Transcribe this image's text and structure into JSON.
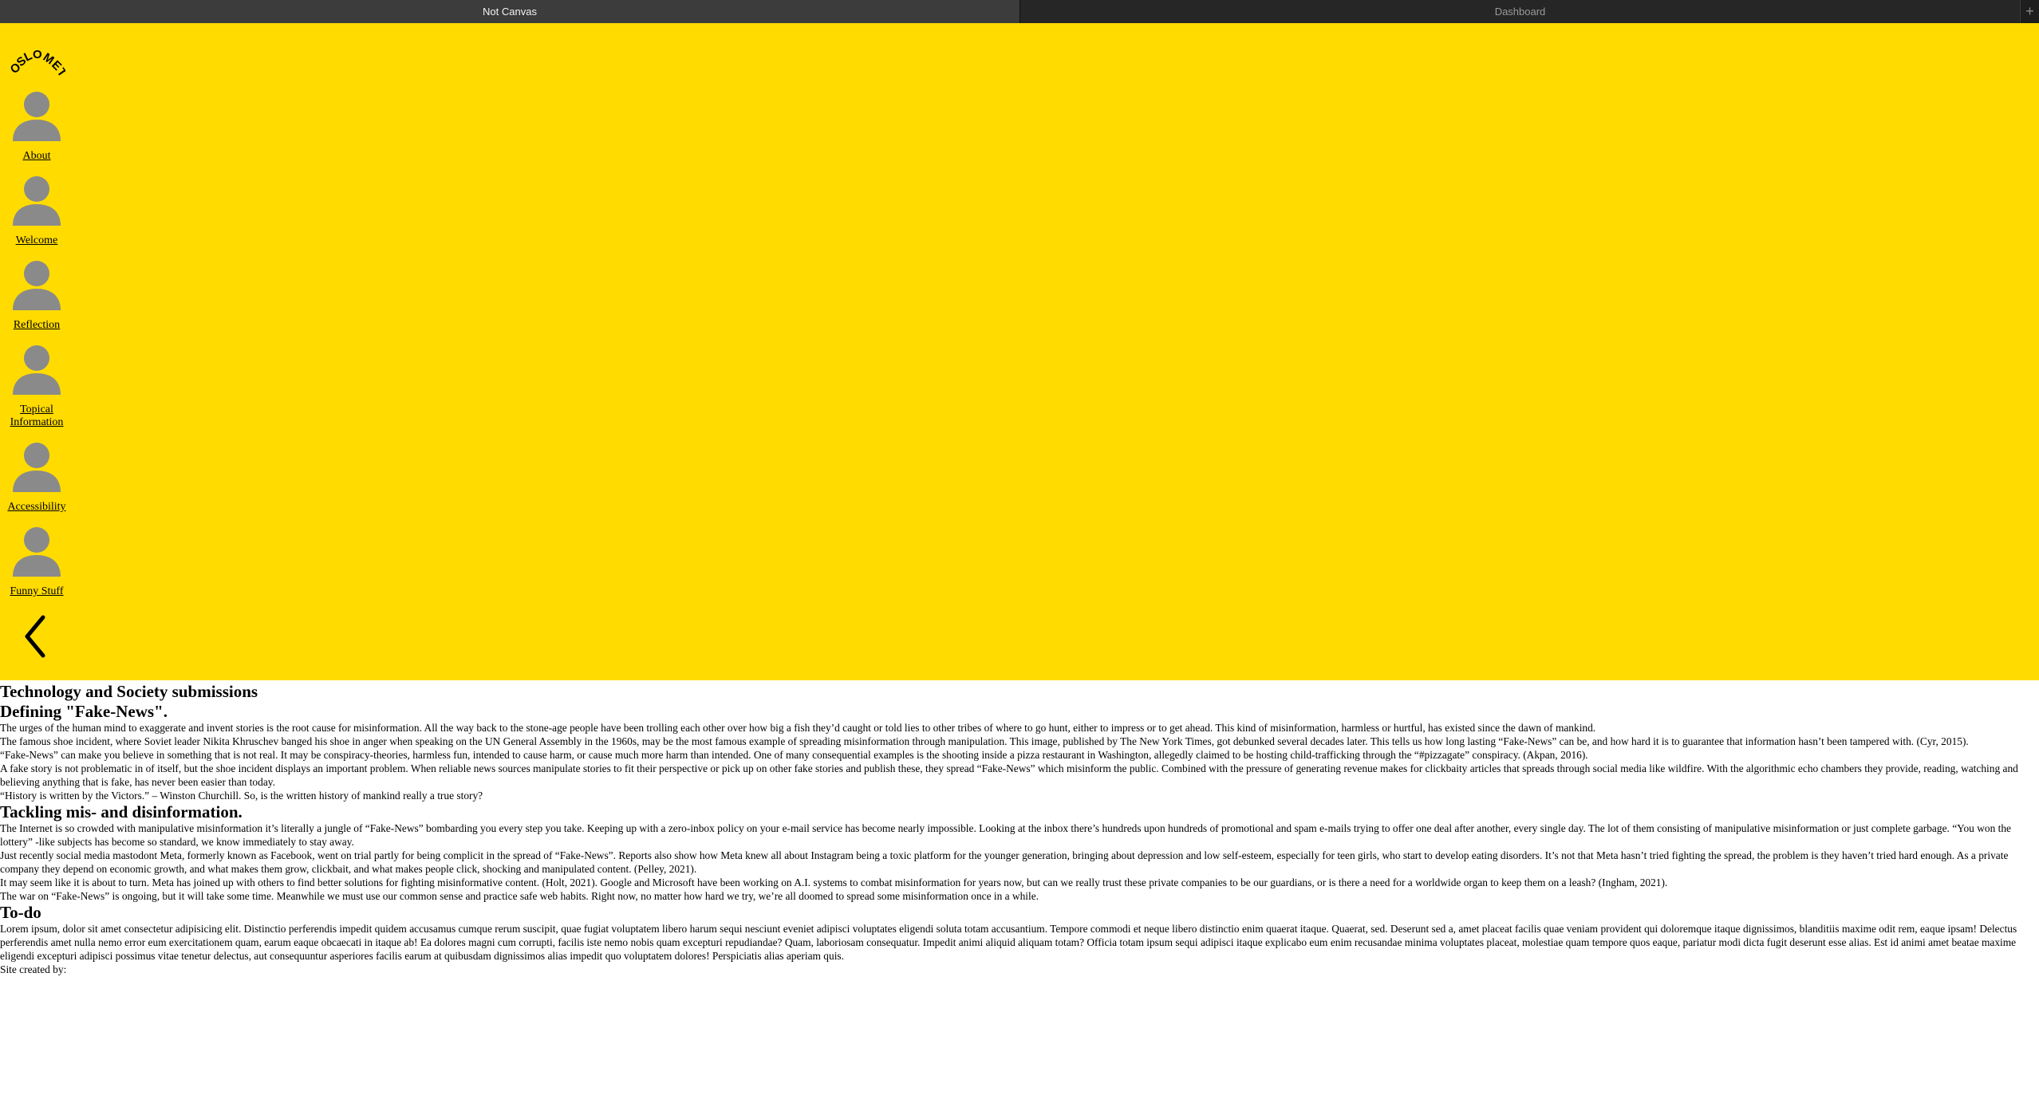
{
  "browser": {
    "tabs": [
      {
        "label": "Not Canvas",
        "active": true
      },
      {
        "label": "Dashboard",
        "active": false
      }
    ],
    "new_tab_label": "+"
  },
  "nav": {
    "background": "#ffdb00",
    "logo_text": "OSLOMET",
    "items": [
      {
        "label": "About",
        "icon": "user-avatar-icon"
      },
      {
        "label": "Welcome",
        "icon": "user-avatar-icon"
      },
      {
        "label": "Reflection",
        "icon": "user-avatar-icon"
      },
      {
        "label": "Topical Information",
        "icon": "user-avatar-icon"
      },
      {
        "label": "Accessibility",
        "icon": "user-avatar-icon"
      },
      {
        "label": "Funny Stuff",
        "icon": "user-avatar-icon"
      }
    ],
    "collapse_icon": "chevron-left-icon"
  },
  "main": {
    "title": "Technology and Society submissions",
    "sections": [
      {
        "heading": "Defining \"Fake-News\".",
        "paragraphs": [
          "The urges of the human mind to exaggerate and invent stories is the root cause for misinformation. All the way back to the stone-age people have been trolling each other over how big a fish they’d caught or told lies to other tribes of where to go hunt, either to impress or to get ahead. This kind of misinformation, harmless or hurtful, has existed since the dawn of mankind.",
          "The famous shoe incident, where Soviet leader Nikita Khruschev banged his shoe in anger when speaking on the UN General Assembly in the 1960s, may be the most famous example of spreading misinformation through manipulation. This image, published by The New York Times, got debunked several decades later. This tells us how long lasting “Fake-News” can be, and how hard it is to guarantee that information hasn’t been tampered with. (Cyr, 2015).",
          "“Fake-News” can make you believe in something that is not real. It may be conspiracy-theories, harmless fun, intended to cause harm, or cause much more harm than intended. One of many consequential examples is the shooting inside a pizza restaurant in Washington, allegedly claimed to be hosting child-trafficking through the “#pizzagate” conspiracy. (Akpan, 2016).",
          "A fake story is not problematic in of itself, but the shoe incident displays an important problem. When reliable news sources manipulate stories to fit their perspective or pick up on other fake stories and publish these, they spread “Fake-News” which misinform the public. Combined with the pressure of generating revenue makes for clickbaity articles that spreads through social media like wildfire. With the algorithmic echo chambers they provide, reading, watching and believing anything that is fake, has never been easier than today.",
          "“History is written by the Victors.” – Winston Churchill. So, is the written history of mankind really a true story?"
        ]
      },
      {
        "heading": "Tackling mis- and disinformation.",
        "paragraphs": [
          "The Internet is so crowded with manipulative misinformation it’s literally a jungle of “Fake-News” bombarding you every step you take. Keeping up with a zero-inbox policy on your e-mail service has become nearly impossible. Looking at the inbox there’s hundreds upon hundreds of promotional and spam e-mails trying to offer one deal after another, every single day. The lot of them consisting of manipulative misinformation or just complete garbage. “You won the lottery” -like subjects has become so standard, we know immediately to stay away.",
          "Just recently social media mastodont Meta, formerly known as Facebook, went on trial partly for being complicit in the spread of “Fake-News”. Reports also show how Meta knew all about Instagram being a toxic platform for the younger generation, bringing about depression and low self-esteem, especially for teen girls, who start to develop eating disorders. It’s not that Meta hasn’t tried fighting the spread, the problem is they haven’t tried hard enough. As a private company they depend on economic growth, and what makes them grow, clickbait, and what makes people click, shocking and manipulated content. (Pelley, 2021).",
          "It may seem like it is about to turn. Meta has joined up with others to find better solutions for fighting misinformative content. (Holt, 2021). Google and Microsoft have been working on A.I. systems to combat misinformation for years now, but can we really trust these private companies to be our guardians, or is there a need for a worldwide organ to keep them on a leash? (Ingham, 2021).",
          "The war on “Fake-News” is ongoing, but it will take some time. Meanwhile we must use our common sense and practice safe web habits. Right now, no matter how hard we try, we’re all doomed to spread some misinformation once in a while."
        ]
      },
      {
        "heading": "To-do",
        "paragraphs": [
          "Lorem ipsum, dolor sit amet consectetur adipisicing elit. Distinctio perferendis impedit quidem accusamus cumque rerum suscipit, quae fugiat voluptatem libero harum sequi nesciunt eveniet adipisci voluptates eligendi soluta totam accusantium. Tempore commodi et neque libero distinctio enim quaerat itaque. Quaerat, sed. Deserunt sed a, amet placeat facilis quae veniam provident qui doloremque itaque dignissimos, blanditiis maxime odit rem, eaque ipsam! Delectus perferendis amet nulla nemo error eum exercitationem quam, earum eaque obcaecati in itaque ab! Ea dolores magni cum corrupti, facilis iste nemo nobis quam excepturi repudiandae? Quam, laboriosam consequatur. Impedit animi aliquid aliquam totam? Officia totam ipsum sequi adipisci itaque explicabo eum enim recusandae minima voluptates placeat, molestiae quam tempore quos eaque, pariatur modi dicta fugit deserunt esse alias. Est id animi amet beatae maxime eligendi excepturi adipisci possimus vitae tenetur delectus, aut consequuntur asperiores facilis earum at quibusdam dignissimos alias impedit quo voluptatem dolores! Perspiciatis alias aperiam quis."
        ]
      }
    ],
    "footer": "Site created by:"
  }
}
